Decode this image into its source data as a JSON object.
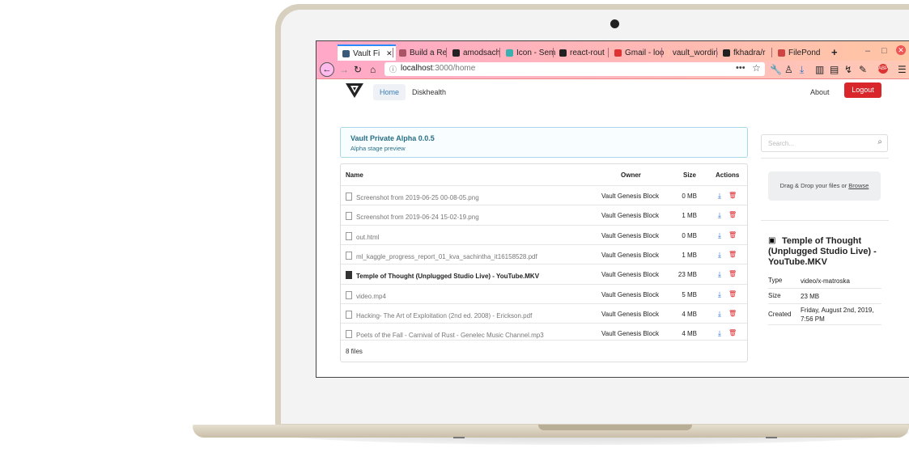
{
  "browser": {
    "tabs": [
      {
        "label": "Vault Fi",
        "color": "#3a5a7a"
      },
      {
        "label": "Build a Re",
        "color": "#a56"
      },
      {
        "label": "amodsach",
        "color": "#222"
      },
      {
        "label": "Icon - Sem",
        "color": "#3ab0b0"
      },
      {
        "label": "react-rout",
        "color": "#222"
      },
      {
        "label": "Gmail - loo",
        "color": "#d33"
      },
      {
        "label": "vault_wordin",
        "color": "#ffc6a5"
      },
      {
        "label": "fkhadra/r",
        "color": "#222"
      },
      {
        "label": "FilePond",
        "color": "#c44"
      }
    ],
    "url_host": "localhost",
    "url_path": ":3000/home"
  },
  "app": {
    "nav": {
      "home": "Home",
      "diskhealth": "Diskhealth",
      "about": "About",
      "logout": "Logout"
    },
    "banner": {
      "title": "Vault Private Alpha 0.0.5",
      "subtitle": "Alpha stage preview"
    },
    "table": {
      "headers": {
        "name": "Name",
        "owner": "Owner",
        "size": "Size",
        "actions": "Actions"
      },
      "rows": [
        {
          "name": "Screenshot from 2019-06-25 00-08-05.png",
          "owner": "Vault Genesis Block",
          "size": "0 MB"
        },
        {
          "name": "Screenshot from 2019-06-24 15-02-19.png",
          "owner": "Vault Genesis Block",
          "size": "1 MB"
        },
        {
          "name": "out.html",
          "owner": "Vault Genesis Block",
          "size": "0 MB"
        },
        {
          "name": "ml_kaggle_progress_report_01_kva_sachintha_it16158528.pdf",
          "owner": "Vault Genesis Block",
          "size": "1 MB"
        },
        {
          "name": "Temple of Thought (Unplugged Studio Live) - YouTube.MKV",
          "owner": "Vault Genesis Block",
          "size": "23 MB"
        },
        {
          "name": "video.mp4",
          "owner": "Vault Genesis Block",
          "size": "5 MB"
        },
        {
          "name": "Hacking- The Art of Exploitation (2nd ed. 2008) - Erickson.pdf",
          "owner": "Vault Genesis Block",
          "size": "4 MB"
        },
        {
          "name": "Poets of the Fall - Carnival of Rust - Genelec Music Channel.mp3",
          "owner": "Vault Genesis Block",
          "size": "4 MB"
        }
      ],
      "footer": "8 files"
    },
    "search": {
      "placeholder": "Search..."
    },
    "dropzone": {
      "text": "Drag & Drop your files or ",
      "browse": "Browse"
    },
    "details": {
      "title": "Temple of Thought (Unplugged Studio Live) - YouTube.MKV",
      "type_label": "Type",
      "type_value": "video/x-matroska",
      "size_label": "Size",
      "size_value": "23 MB",
      "created_label": "Created",
      "created_value": "Friday, August 2nd, 2019, 7:56 PM"
    }
  },
  "colors": {
    "logout": "#d9262b",
    "download": "#2a72c9",
    "delete": "#d9262b",
    "tabbar_gradient": [
      "#ffa8c8",
      "#ffc6a5"
    ]
  }
}
